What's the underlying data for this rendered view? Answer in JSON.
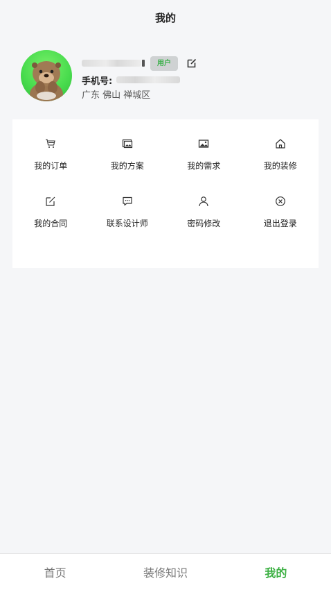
{
  "header": {
    "title": "我的"
  },
  "profile": {
    "role_badge": "用户",
    "phone_label": "手机号:",
    "location": "广东 佛山 禅城区"
  },
  "menu": {
    "items": [
      {
        "label": "我的订单",
        "icon": "cart-icon"
      },
      {
        "label": "我的方案",
        "icon": "gallery-icon"
      },
      {
        "label": "我的需求",
        "icon": "image-icon"
      },
      {
        "label": "我的装修",
        "icon": "home-icon"
      },
      {
        "label": "我的合同",
        "icon": "edit-icon"
      },
      {
        "label": "联系设计师",
        "icon": "chat-icon"
      },
      {
        "label": "密码修改",
        "icon": "user-icon"
      },
      {
        "label": "退出登录",
        "icon": "close-circle-icon"
      }
    ]
  },
  "tabbar": {
    "items": [
      {
        "label": "首页"
      },
      {
        "label": "装修知识"
      },
      {
        "label": "我的"
      }
    ],
    "active_color": "#3cb043"
  },
  "colors": {
    "accent": "#3cb043",
    "background": "#f5f6f8",
    "badge_bg": "#cfd2d3"
  }
}
